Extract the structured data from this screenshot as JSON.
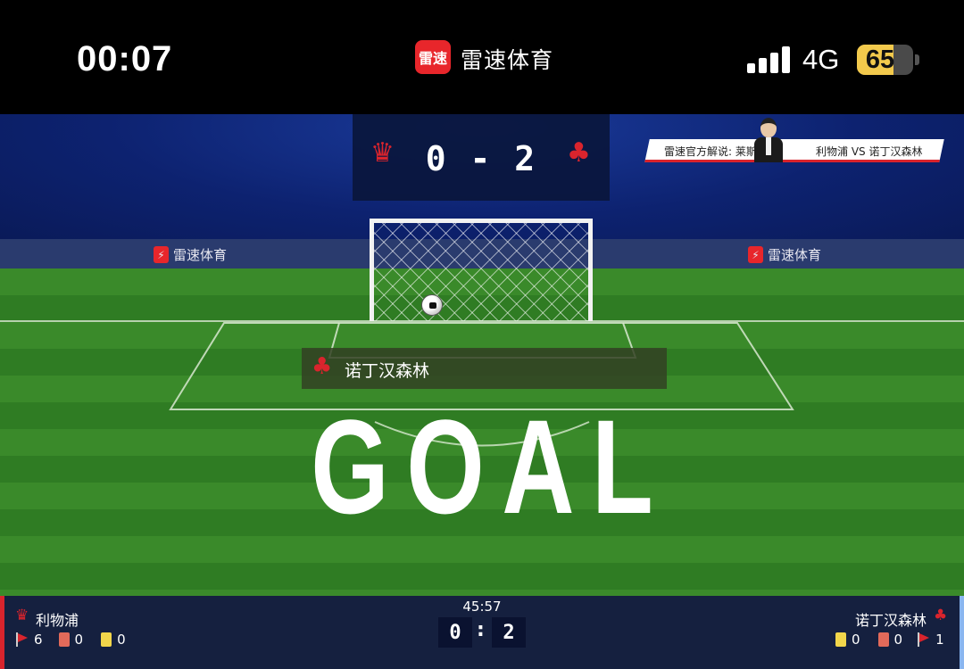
{
  "status_bar": {
    "time": "00:07",
    "app_logo_text": "雷速",
    "app_name": "雷速体育",
    "network": "4G",
    "battery": "65",
    "battery_level": 0.65,
    "icons": [
      "signal-icon",
      "battery-icon"
    ]
  },
  "match": {
    "home_team": "利物浦",
    "away_team": "诺丁汉森林",
    "home_score": "0",
    "away_score": "2",
    "score_display": "0 - 2",
    "clock": "45:57"
  },
  "commentator": {
    "label": "雷速官方解说: 莱斯",
    "matchup": "利物浦 VS 诺丁汉森林"
  },
  "ad_board": {
    "brand": "雷速体育"
  },
  "goal_caption": {
    "team": "诺丁汉森林"
  },
  "goal_banner": "GOAL",
  "stats": {
    "home": {
      "corners": "6",
      "red_cards": "0",
      "yellow_cards": "0"
    },
    "away": {
      "yellow_cards": "0",
      "red_cards": "0",
      "corners": "1"
    }
  },
  "colors": {
    "brand_red": "#e8262b",
    "pitch_green": "#3a8a2a",
    "hud_navy": "#15203f",
    "battery_yellow": "#f2c94c"
  }
}
